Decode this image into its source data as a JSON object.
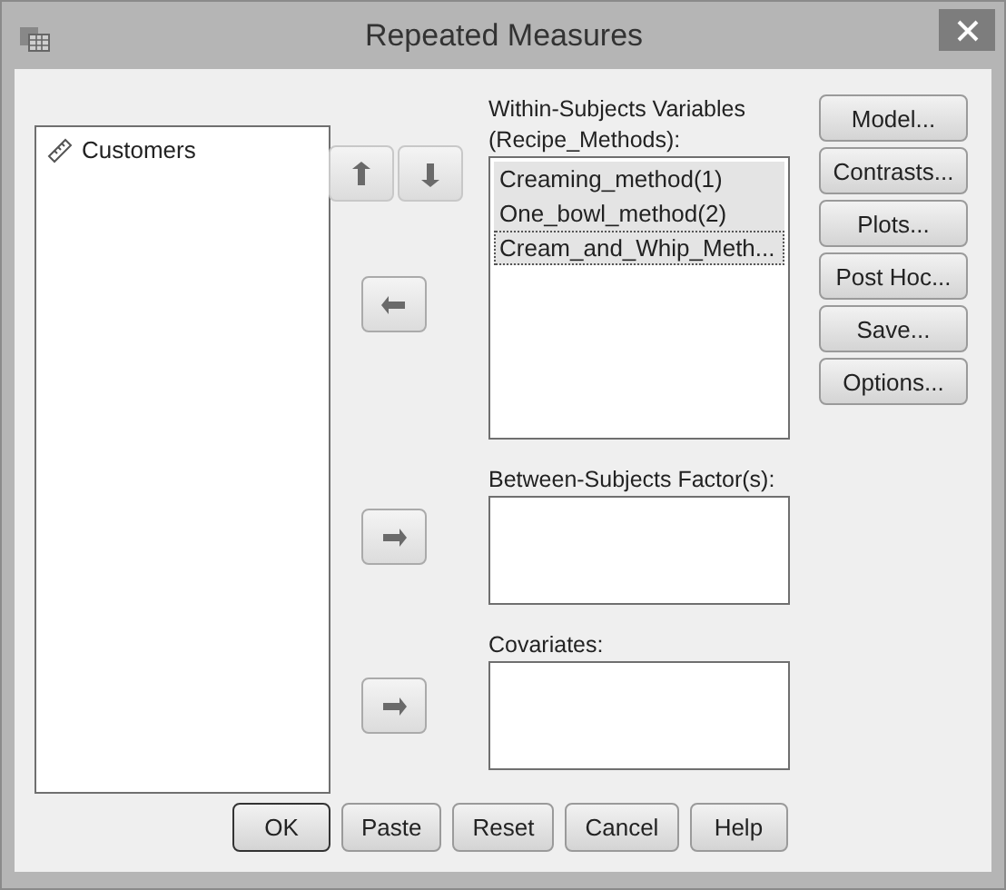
{
  "window": {
    "title": "Repeated Measures"
  },
  "source_list": {
    "items": [
      {
        "name": "Customers",
        "kind": "scale",
        "selected": false
      }
    ]
  },
  "within_subjects": {
    "label": "Within-Subjects Variables",
    "sublabel": "(Recipe_Methods):",
    "items": [
      {
        "name": "Creaming_method(1)",
        "selected": true,
        "focused": false
      },
      {
        "name": "One_bowl_method(2)",
        "selected": true,
        "focused": false
      },
      {
        "name": "Cream_and_Whip_Meth...",
        "selected": true,
        "focused": true
      }
    ]
  },
  "between_subjects": {
    "label": "Between-Subjects Factor(s):"
  },
  "covariates": {
    "label": "Covariates:"
  },
  "side_buttons": [
    "Model...",
    "Contrasts...",
    "Plots...",
    "Post Hoc...",
    "Save...",
    "Options..."
  ],
  "bottom_buttons": [
    {
      "label": "OK",
      "default": true
    },
    {
      "label": "Paste",
      "default": false
    },
    {
      "label": "Reset",
      "default": false
    },
    {
      "label": "Cancel",
      "default": false
    },
    {
      "label": "Help",
      "default": false
    }
  ]
}
